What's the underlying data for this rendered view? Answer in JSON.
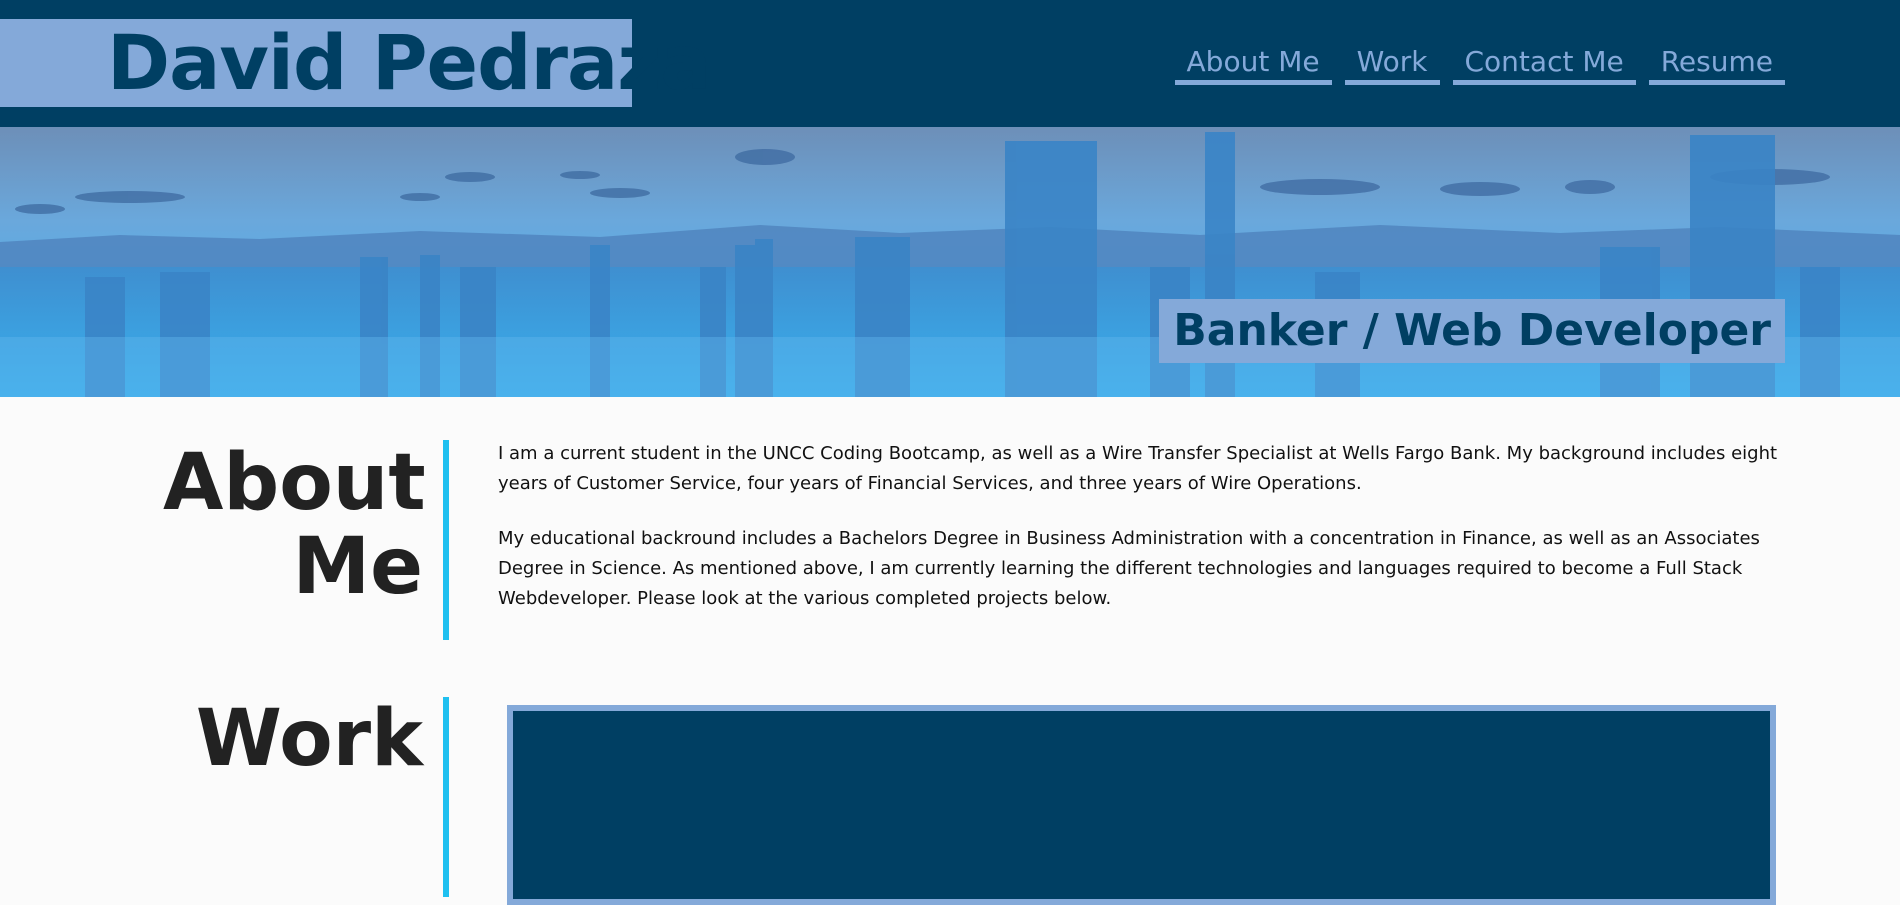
{
  "header": {
    "name": "David Pedraza",
    "nav": [
      {
        "label": "About Me"
      },
      {
        "label": "Work"
      },
      {
        "label": "Contact Me"
      },
      {
        "label": "Resume"
      }
    ]
  },
  "hero": {
    "tagline": "Banker / Web Developer",
    "image": "city-skyline"
  },
  "about": {
    "title_line1": "About",
    "title_line2": "Me",
    "paragraphs": [
      "I am a current student in the UNCC Coding Bootcamp, as well as a Wire Transfer Specialist at Wells Fargo Bank. My background includes eight years of Customer Service, four years of Financial Services, and three years of Wire Operations.",
      "My educational backround includes a Bachelors Degree in Business Administration with a concentration in Finance, as well as an Associates Degree in Science. As mentioned above, I am currently learning the different technologies and languages required to become a Full Stack Webdeveloper. Please look at the various completed projects below."
    ]
  },
  "work": {
    "title": "Work"
  },
  "colors": {
    "header_bg": "#003f63",
    "accent": "#84a9d9",
    "rule": "#1fc0f0",
    "text": "#222222"
  }
}
